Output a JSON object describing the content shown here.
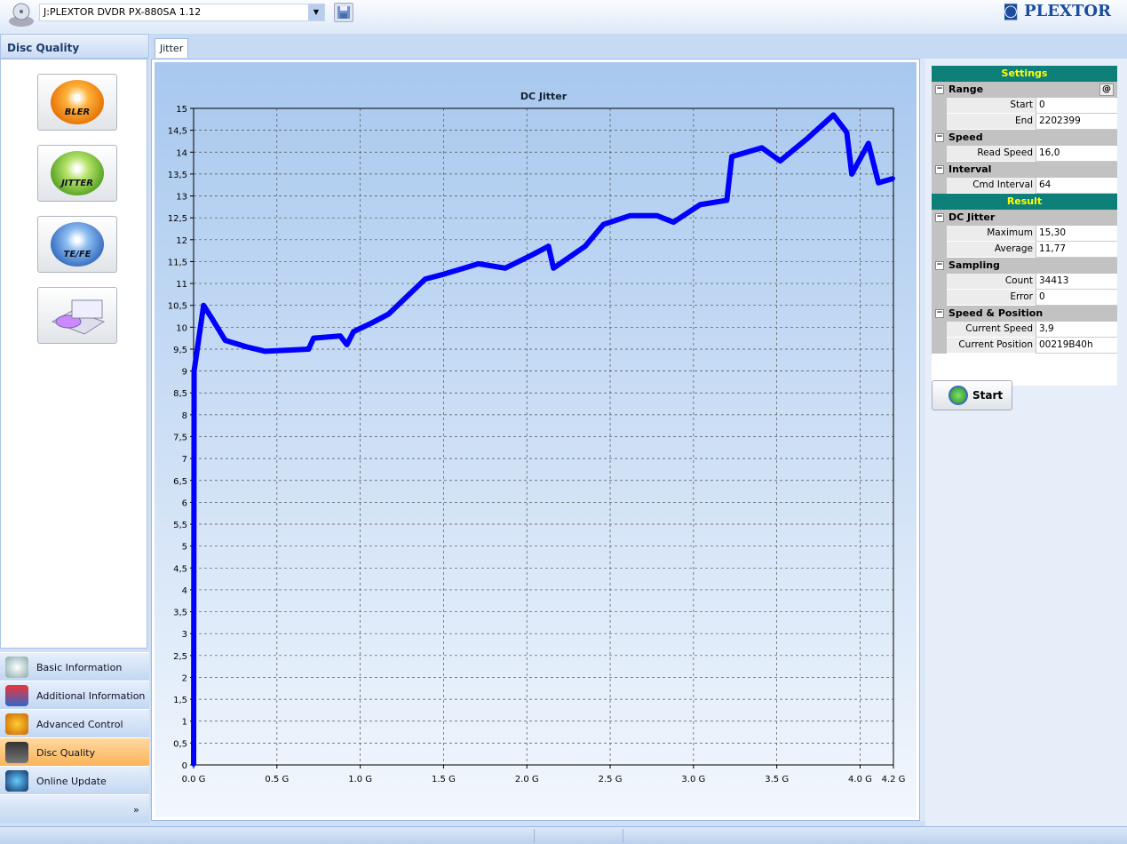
{
  "toolbar": {
    "drive": "J:PLEXTOR DVDR   PX-880SA  1.12",
    "logo": "PLEXTOR"
  },
  "left_panel": {
    "title": "Disc Quality",
    "tools": [
      {
        "label": "BLER"
      },
      {
        "label": "JITTER"
      },
      {
        "label": "TE/FE"
      },
      {
        "label": ""
      }
    ],
    "nav": [
      {
        "label": "Basic Information"
      },
      {
        "label": "Additional Information"
      },
      {
        "label": "Advanced Control"
      },
      {
        "label": "Disc Quality",
        "active": true
      },
      {
        "label": "Online Update"
      }
    ],
    "more": "»"
  },
  "tabs": [
    {
      "label": "Jitter"
    }
  ],
  "properties": {
    "settings_title": "Settings",
    "result_title": "Result",
    "at_label": "@",
    "range": {
      "title": "Range",
      "start_k": "Start",
      "start": "0",
      "end_k": "End",
      "end": "2202399"
    },
    "speed": {
      "title": "Speed",
      "read_k": "Read Speed",
      "read": "16,0"
    },
    "interval": {
      "title": "Interval",
      "cmd_k": "Cmd Interval",
      "cmd": "64"
    },
    "dc_jitter": {
      "title": "DC Jitter",
      "max_k": "Maximum",
      "max": "15,30",
      "avg_k": "Average",
      "avg": "11,77"
    },
    "sampling": {
      "title": "Sampling",
      "count_k": "Count",
      "count": "34413",
      "error_k": "Error",
      "error": "0"
    },
    "speed_pos": {
      "title": "Speed & Position",
      "cur_speed_k": "Current Speed",
      "cur_speed": "3,9",
      "cur_pos_k": "Current Position",
      "cur_pos": "00219B40h"
    }
  },
  "start_label": "Start",
  "colors": {
    "series": "#0000ff",
    "header": "#0e7f79",
    "active_nav": "#f9b45a"
  },
  "chart_data": {
    "type": "line",
    "title": "DC Jitter",
    "xlabel": "",
    "ylabel": "",
    "xlim": [
      0,
      4.2
    ],
    "ylim": [
      0,
      15
    ],
    "grid": true,
    "x_ticks": [
      "0.0 G",
      "0.5 G",
      "1.0 G",
      "1.5 G",
      "2.0 G",
      "2.5 G",
      "3.0 G",
      "3.5 G",
      "4.0 G",
      "4.2 G"
    ],
    "x_tick_values": [
      0,
      0.5,
      1,
      1.5,
      2,
      2.5,
      3,
      3.5,
      4,
      4.2
    ],
    "y_ticks": [
      "0",
      "0,5",
      "1",
      "1,5",
      "2",
      "2,5",
      "3",
      "3,5",
      "4",
      "4,5",
      "5",
      "5,5",
      "6",
      "6,5",
      "7",
      "7,5",
      "8",
      "8,5",
      "9",
      "9,5",
      "10",
      "10,5",
      "11",
      "11,5",
      "12",
      "12,5",
      "13",
      "13,5",
      "14",
      "14,5",
      "15"
    ],
    "series": [
      {
        "x": [
          0,
          0.003,
          0.06,
          0.11,
          0.19,
          0.32,
          0.43,
          0.69,
          0.72,
          0.88,
          0.92,
          0.96,
          1.07,
          1.17,
          1.28,
          1.39,
          1.49,
          1.71,
          1.87,
          2.03,
          2.13,
          2.16,
          2.35,
          2.46,
          2.62,
          2.78,
          2.88,
          3.04,
          3.2,
          3.23,
          3.41,
          3.52,
          3.68,
          3.84,
          3.92,
          3.95,
          4.05,
          4.11,
          4.2
        ],
        "y": [
          0,
          9.0,
          10.5,
          10.2,
          9.7,
          9.55,
          9.45,
          9.5,
          9.75,
          9.8,
          9.6,
          9.9,
          10.1,
          10.3,
          10.7,
          11.1,
          11.2,
          11.45,
          11.35,
          11.65,
          11.85,
          11.35,
          11.85,
          12.35,
          12.55,
          12.55,
          12.4,
          12.8,
          12.9,
          13.9,
          14.1,
          13.8,
          14.3,
          14.85,
          14.45,
          13.5,
          14.2,
          13.3,
          13.4
        ]
      }
    ]
  }
}
